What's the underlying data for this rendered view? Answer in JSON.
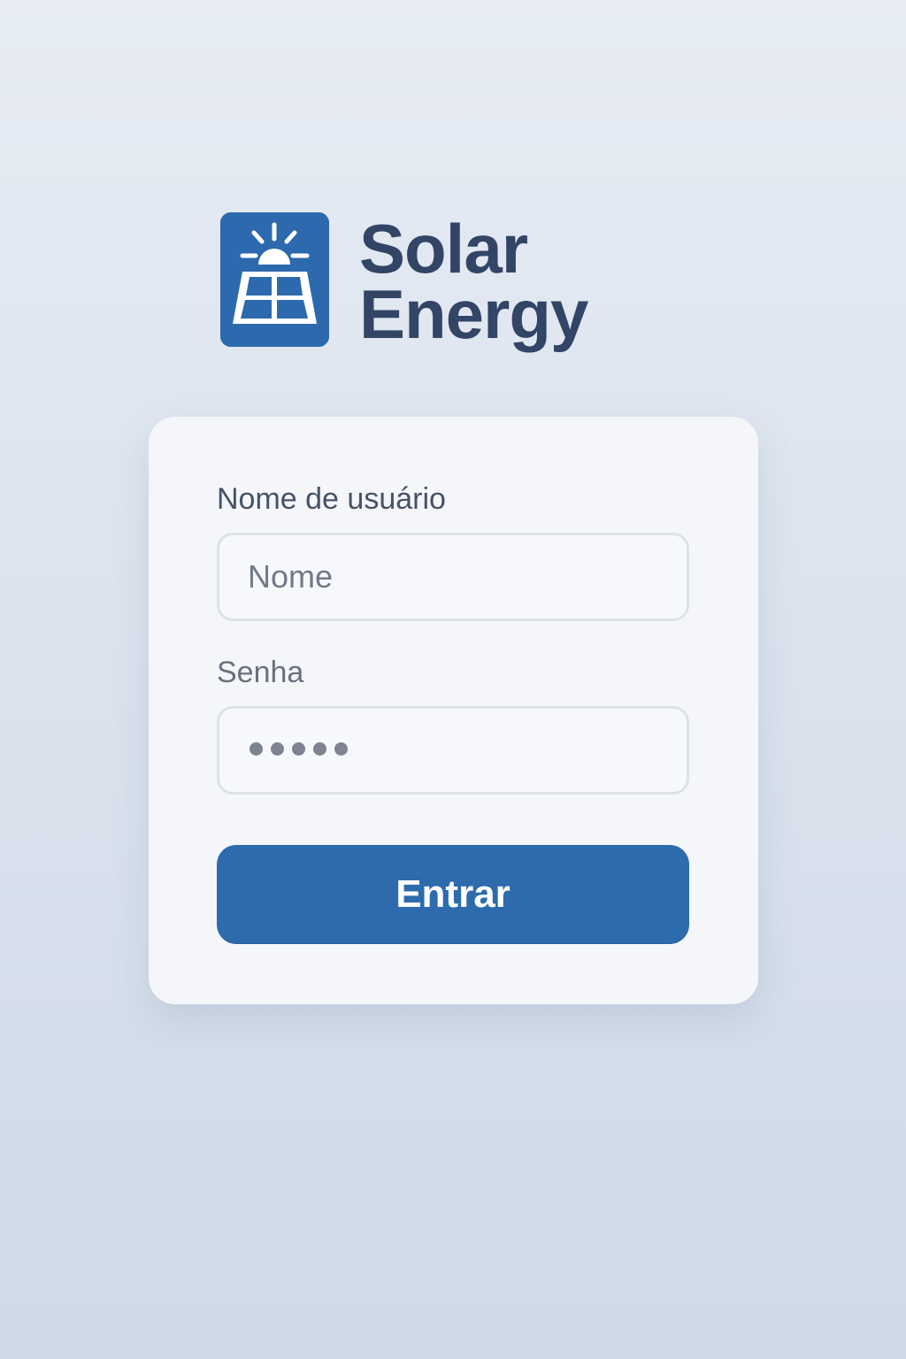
{
  "brand": {
    "line1": "Solar",
    "line2": "Energy",
    "logo_icon": "solar-panel-sun-icon"
  },
  "form": {
    "username_label": "Nome de usuário",
    "username_placeholder": "Nome",
    "password_label": "Senha",
    "password_mask": "•••••",
    "submit_label": "Entrar"
  },
  "colors": {
    "brand_blue": "#2c6aad",
    "title_text": "#334566",
    "card_bg": "#f5f6fa"
  }
}
